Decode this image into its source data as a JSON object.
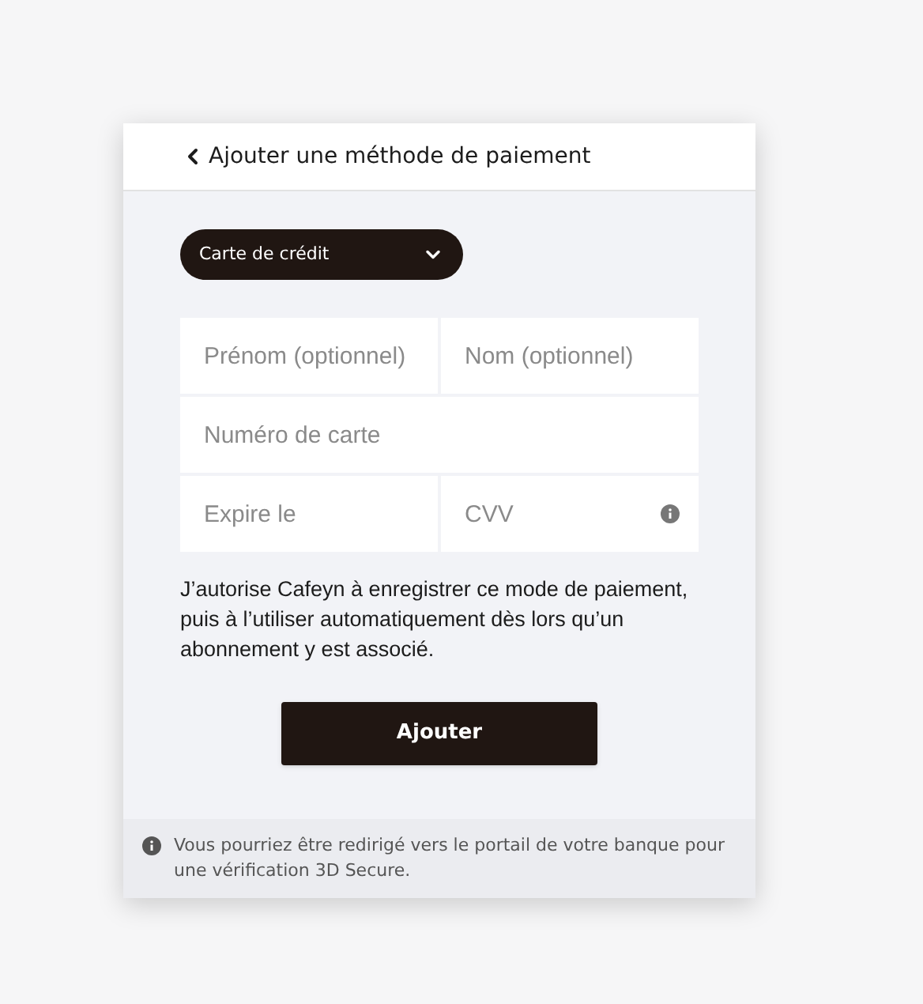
{
  "header": {
    "title": "Ajouter une méthode de paiement"
  },
  "method_select": {
    "value": "Carte de crédit"
  },
  "fields": [
    {
      "placeholder": "Prénom (optionnel)"
    },
    {
      "placeholder": "Nom (optionnel)"
    },
    {
      "placeholder": "Numéro de carte"
    },
    {
      "placeholder": "Expire le"
    },
    {
      "placeholder": "CVV"
    }
  ],
  "consent": "J’autorise Cafeyn à enregistrer ce mode de paiement, puis à l’utiliser automatiquement dès lors qu’un abonnement y est associé.",
  "submit_button": "Ajouter",
  "notice": "Vous pourriez être redirigé vers le portail de votre banque pour une vérification 3D Secure."
}
